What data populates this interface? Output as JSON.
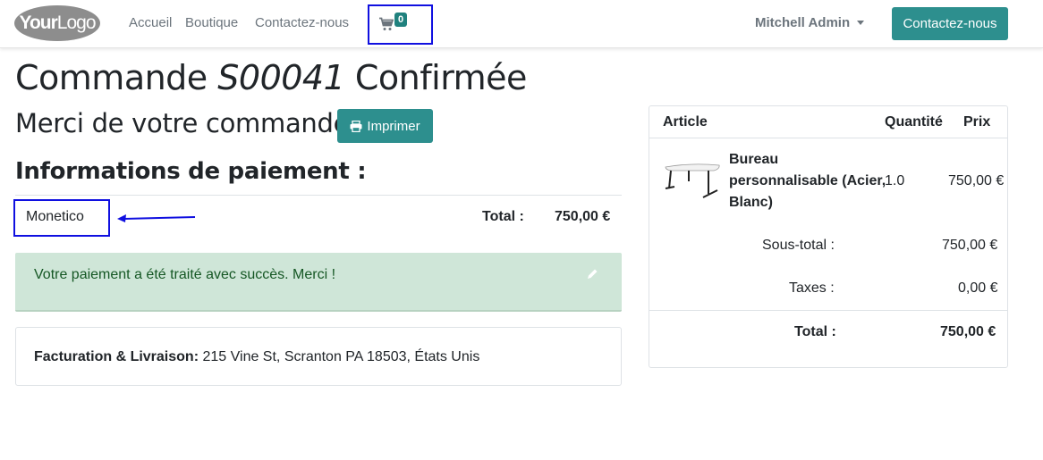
{
  "navbar": {
    "logo": {
      "part1": "Your",
      "part2": "Logo"
    },
    "links": [
      "Accueil",
      "Boutique",
      "Contactez-nous"
    ],
    "cart_count": "0",
    "user": "Mitchell Admin",
    "contact_button": "Contactez-nous"
  },
  "order": {
    "title_prefix": "Commande",
    "reference": "S00041",
    "status": "Confirmée",
    "thanks": "Merci de votre commande.",
    "print_button": "Imprimer"
  },
  "payment": {
    "heading": "Informations de paiement :",
    "method": "Monetico",
    "total_label": "Total :",
    "total_value": "750,00 €",
    "success_message": "Votre paiement a été traité avec succès. Merci !"
  },
  "billing": {
    "label": "Facturation & Livraison:",
    "address": "215 Vine St, Scranton PA 18503, États Unis"
  },
  "summary": {
    "headers": {
      "article": "Article",
      "quantity": "Quantité",
      "price": "Prix"
    },
    "item": {
      "name": "Bureau personnalisable (Acier, Blanc)",
      "quantity": "1.0",
      "price": "750,00 €"
    },
    "subtotal_label": "Sous-total :",
    "subtotal_value": "750,00 €",
    "taxes_label": "Taxes :",
    "taxes_value": "0,00 €",
    "total_label": "Total :",
    "total_value": "750,00 €"
  },
  "colors": {
    "primary": "#2d8f8e",
    "highlight_box": "#1010e0",
    "success_bg": "#cfe6d8",
    "success_text": "#155724"
  },
  "icons": [
    "shopping-cart-icon",
    "printer-icon",
    "pencil-icon",
    "arrow-annotation"
  ]
}
